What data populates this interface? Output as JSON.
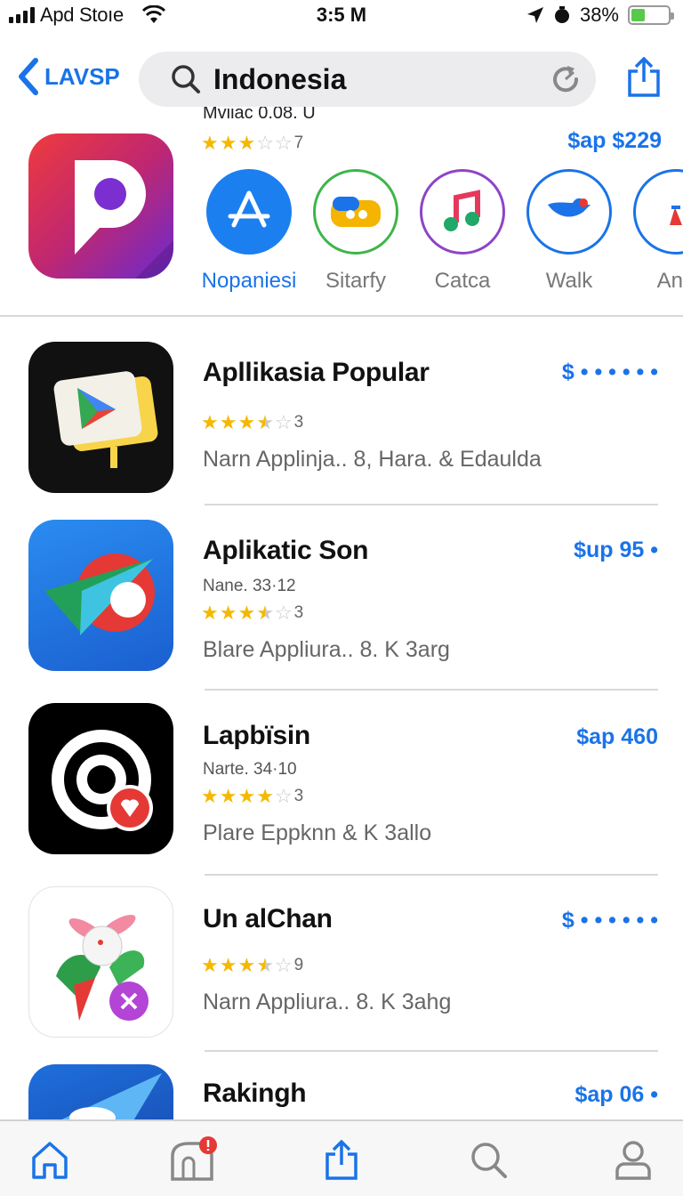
{
  "status_bar": {
    "carrier": "Apd Stoıe",
    "time": "3:5 M",
    "battery": "38%",
    "battery_level": 0.38
  },
  "nav": {
    "back_label": "LAVSP",
    "search_text": "Indonesia"
  },
  "featured": {
    "subtitle": "Mviiac 0.08. U",
    "rating_count": "7",
    "rating_stars": 3,
    "price": "$ap $229",
    "categories": [
      {
        "label": "Nopaniesi",
        "icon": "app-store-icon",
        "active": true
      },
      {
        "label": "Sitarfy",
        "icon": "game-controller-icon",
        "active": false
      },
      {
        "label": "Catca",
        "icon": "music-note-icon",
        "active": false
      },
      {
        "label": "Walk",
        "icon": "bird-icon",
        "active": false
      },
      {
        "label": "And",
        "icon": "flag-icon",
        "active": false
      }
    ]
  },
  "apps": [
    {
      "title": "Apllikasia Popular",
      "subtitle": "",
      "rating_count": "3",
      "rating_stars": 3.5,
      "meta": "Narn  Applinja.. 8,  Hara.  &  Edaulda",
      "price": "$ • • • • • •"
    },
    {
      "title": "Aplikatic Son",
      "subtitle": "Nane.  33·12",
      "rating_count": "3",
      "rating_stars": 3.5,
      "meta": "Blare  Appliura.. 8.  K  3arg",
      "price": "$up 95 •"
    },
    {
      "title": "Lapbïsin",
      "subtitle": "Narte.  34·10",
      "rating_count": "3",
      "rating_stars": 4,
      "meta": "Plare  Eppknn    &  K  3allo",
      "price": "$ap 460"
    },
    {
      "title": "Un alChan",
      "subtitle": "",
      "rating_count": "9",
      "rating_stars": 3.5,
      "meta": "Narn  Appliura.. 8.  K  3ahg",
      "price": "$ • • • • • •"
    },
    {
      "title": "Rakingh",
      "subtitle": "",
      "rating_count": "",
      "rating_stars": 0,
      "meta": "",
      "price": "$ap 06 •"
    }
  ],
  "tab_bar": {
    "tabs": [
      {
        "name": "home",
        "icon": "home-icon",
        "active": true
      },
      {
        "name": "apps",
        "icon": "mailbox-icon",
        "badge": true
      },
      {
        "name": "updates",
        "icon": "share-icon"
      },
      {
        "name": "search",
        "icon": "search-icon"
      },
      {
        "name": "account",
        "icon": "person-icon"
      }
    ]
  },
  "colors": {
    "accent": "#1a73e8",
    "star": "#f5b800",
    "star_empty": "#c9c9c9",
    "badge": "#e53935"
  }
}
